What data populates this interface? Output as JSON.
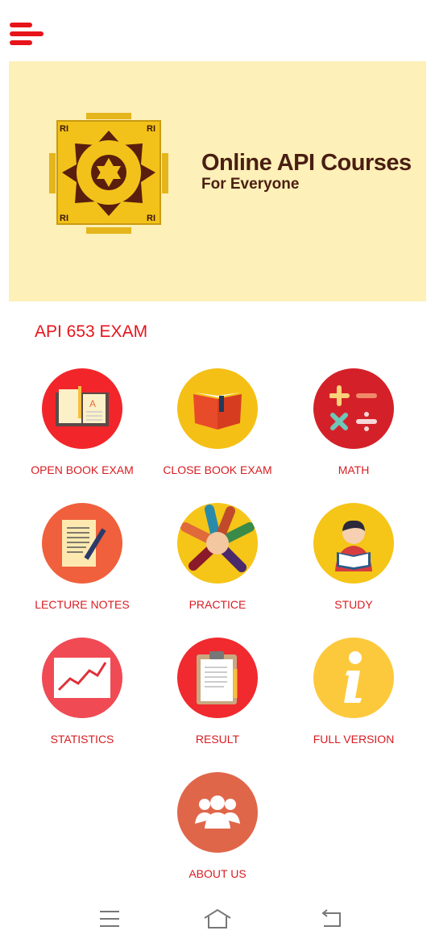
{
  "header": {
    "menu_icon": "hamburger-menu-icon",
    "accent": "#e8141b"
  },
  "banner": {
    "title": "Online API Courses",
    "subtitle": "For Everyone",
    "background": "#fdf0b8"
  },
  "section_title": "API 653 EXAM",
  "tiles": [
    {
      "label": "OPEN BOOK EXAM",
      "icon": "open-book-icon",
      "color": "#f2262a"
    },
    {
      "label": "CLOSE BOOK EXAM",
      "icon": "closed-book-icon",
      "color": "#f5c016"
    },
    {
      "label": "MATH",
      "icon": "math-operators-icon",
      "color": "#d42129"
    },
    {
      "label": "LECTURE NOTES",
      "icon": "notes-pencil-icon",
      "color": "#f0603c"
    },
    {
      "label": "PRACTICE",
      "icon": "team-hands-icon",
      "color": "#f5c518"
    },
    {
      "label": "STUDY",
      "icon": "student-reading-icon",
      "color": "#f5c518"
    },
    {
      "label": "STATISTICS",
      "icon": "line-chart-icon",
      "color": "#f04a55"
    },
    {
      "label": "RESULT",
      "icon": "clipboard-icon",
      "color": "#f02a2e"
    },
    {
      "label": "FULL VERSION",
      "icon": "info-icon",
      "color": "#fdc93c"
    },
    {
      "label": "ABOUT US",
      "icon": "group-users-icon",
      "color": "#e0664a"
    }
  ],
  "navbar": {
    "menu": "recent-apps-icon",
    "home": "home-icon",
    "back": "back-icon"
  }
}
